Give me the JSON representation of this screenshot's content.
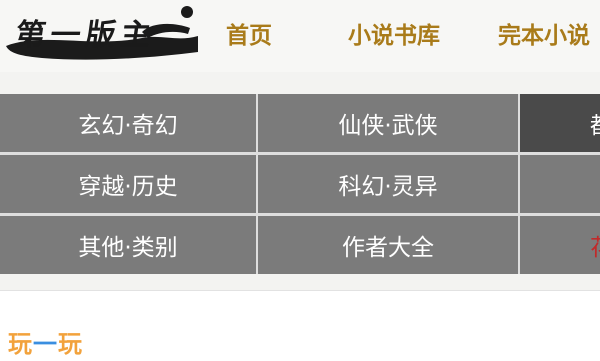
{
  "header": {
    "logo_text": "第一版主",
    "nav": [
      {
        "label": "首页"
      },
      {
        "label": "小说书库"
      },
      {
        "label": "完本小说"
      }
    ]
  },
  "categories": {
    "rows": [
      [
        "玄幻·奇幻",
        "仙侠·武侠",
        "都"
      ],
      [
        "穿越·历史",
        "科幻·灵异",
        ""
      ],
      [
        "其他·类别",
        "作者大全",
        "花"
      ]
    ]
  },
  "watermark": {
    "part1": "玩",
    "part2": "一",
    "part3": "玩"
  },
  "colors": {
    "nav_link": "#a97b1a",
    "cell_bg": "#7b7b7b",
    "cell_active": "#4a4a4a",
    "accent_red": "#c12a2a"
  }
}
